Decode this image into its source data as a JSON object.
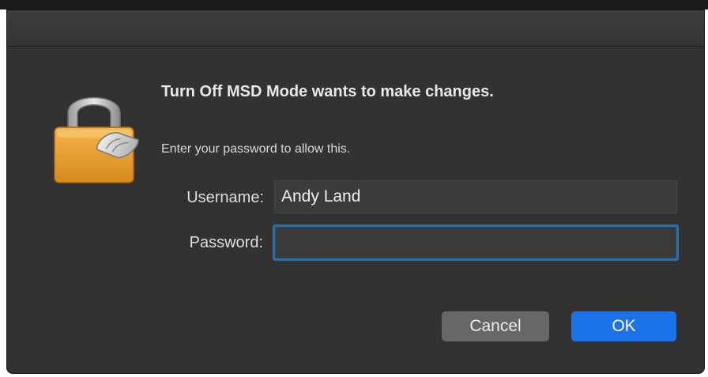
{
  "dialog": {
    "heading": "Turn Off MSD Mode wants to make changes.",
    "subtext": "Enter your password to allow this.",
    "lock_icon": "padlock-with-script-icon",
    "username": {
      "label": "Username:",
      "value": "Andy Land"
    },
    "password": {
      "label": "Password:",
      "value": ""
    },
    "buttons": {
      "cancel_label": "Cancel",
      "ok_label": "OK"
    },
    "colors": {
      "background": "#323232",
      "accent": "#1c72e8",
      "focus_ring": "#2f6ea3",
      "lock_gold": "#e9a43a"
    }
  }
}
